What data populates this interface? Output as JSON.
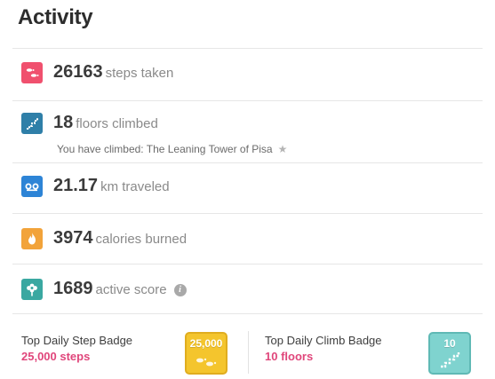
{
  "header": {
    "title": "Activity"
  },
  "stats": [
    {
      "value": "26163",
      "unit": "steps taken",
      "icon": "footsteps-icon",
      "color": "#f0506e"
    },
    {
      "value": "18",
      "unit": "floors climbed",
      "icon": "stairs-icon",
      "color": "#2f7fa8",
      "note": "You have climbed: The Leaning Tower of Pisa",
      "note_icon": "star-icon"
    },
    {
      "value": "21.17",
      "unit": "km traveled",
      "icon": "distance-icon",
      "color": "#2d84d6"
    },
    {
      "value": "3974",
      "unit": "calories burned",
      "icon": "flame-icon",
      "color": "#f2a33a"
    },
    {
      "value": "1689",
      "unit": "active score",
      "icon": "flower-icon",
      "color": "#3aa8a1",
      "info_icon": "info-icon",
      "info_glyph": "i"
    }
  ],
  "badges": [
    {
      "label": "Top Daily Step Badge",
      "value": "25,000 steps",
      "badge_text": "25,000",
      "badge_color": "#f4c52d",
      "icon": "step-badge-icon"
    },
    {
      "label": "Top Daily Climb Badge",
      "value": "10 floors",
      "badge_text": "10",
      "badge_color": "#7fd3cf",
      "icon": "climb-badge-icon"
    }
  ],
  "colors": {
    "accent_pink": "#e0467b",
    "divider": "#e6e6e6"
  }
}
